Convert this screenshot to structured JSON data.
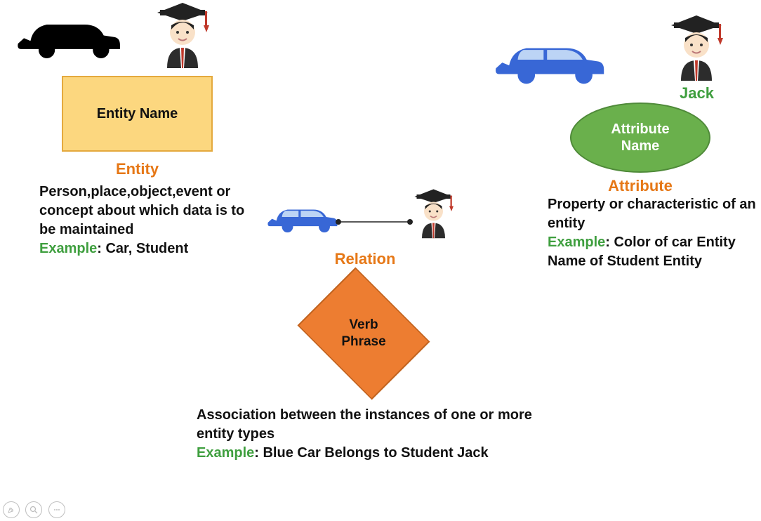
{
  "entity": {
    "box_label": "Entity Name",
    "heading": "Entity",
    "description": "Person,place,object,event or concept about which data is to be maintained",
    "example_label": "Example",
    "example_text": ": Car, Student"
  },
  "relation": {
    "heading": "Relation",
    "diamond_label": "Verb\nPhrase",
    "description": "Association between the instances of one or more entity types",
    "example_label": "Example",
    "example_text": ": Blue Car Belongs to Student Jack"
  },
  "attribute": {
    "name_example": "Jack",
    "ellipse_label": "Attribute\nName",
    "heading": "Attribute",
    "description": "Property or characteristic of an entity",
    "example_label": "Example",
    "example_text": ": Color of car Entity Name of Student Entity"
  }
}
